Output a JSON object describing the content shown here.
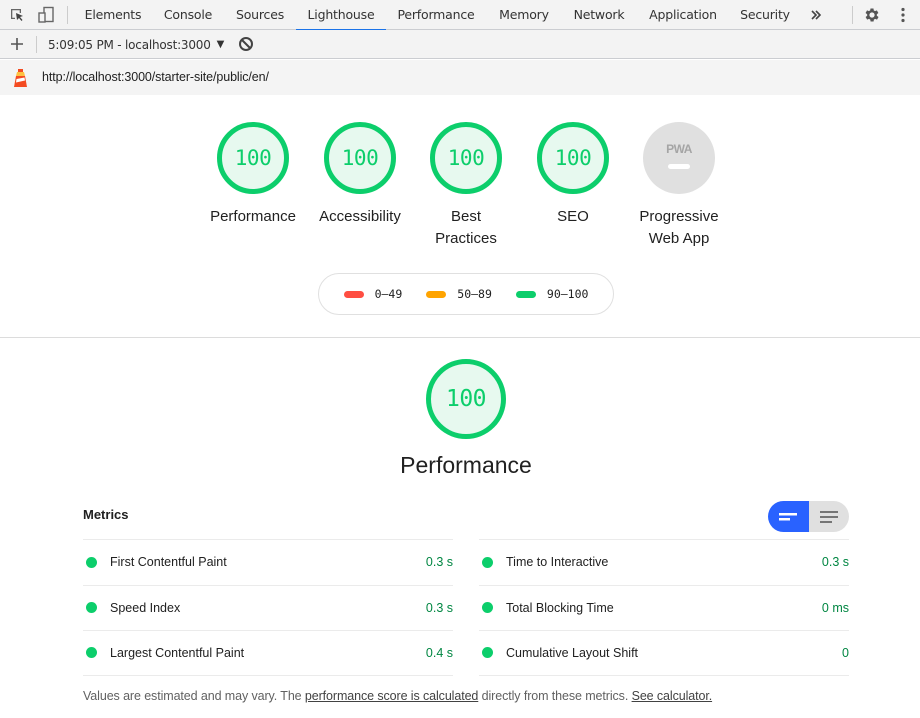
{
  "devtools": {
    "tabs": [
      {
        "label": "Elements",
        "active": false
      },
      {
        "label": "Console",
        "active": false
      },
      {
        "label": "Sources",
        "active": false
      },
      {
        "label": "Lighthouse",
        "active": true
      },
      {
        "label": "Performance",
        "active": false
      },
      {
        "label": "Memory",
        "active": false
      },
      {
        "label": "Network",
        "active": false
      },
      {
        "label": "Application",
        "active": false
      },
      {
        "label": "Security",
        "active": false
      }
    ],
    "more_tabs_icon": "chevron-double-right-icon",
    "accent_color": "#1a73e8"
  },
  "toolbar": {
    "report_selector": "5:09:05 PM - localhost:3000",
    "new_report_icon": "plus-icon",
    "clear_icon": "block-icon"
  },
  "report": {
    "url": "http://localhost:3000/starter-site/public/en/",
    "gauges": [
      {
        "label": "Performance",
        "score": "100"
      },
      {
        "label": "Accessibility",
        "score": "100"
      },
      {
        "label": "Best Practices",
        "score": "100"
      },
      {
        "label": "SEO",
        "score": "100"
      },
      {
        "label": "Progressive Web App",
        "score": null,
        "badge": "PWA"
      }
    ],
    "legend": [
      {
        "label": "0–49",
        "color": "#ff4e42"
      },
      {
        "label": "50–89",
        "color": "#ffa400"
      },
      {
        "label": "90–100",
        "color": "#0cce6b"
      }
    ],
    "performance": {
      "score": "100",
      "title": "Performance",
      "metrics_header": "Metrics",
      "metrics_left": [
        {
          "name": "First Contentful Paint",
          "value": "0.3 s"
        },
        {
          "name": "Speed Index",
          "value": "0.3 s"
        },
        {
          "name": "Largest Contentful Paint",
          "value": "0.4 s"
        }
      ],
      "metrics_right": [
        {
          "name": "Time to Interactive",
          "value": "0.3 s"
        },
        {
          "name": "Total Blocking Time",
          "value": "0 ms"
        },
        {
          "name": "Cumulative Layout Shift",
          "value": "0"
        }
      ],
      "footnote": {
        "prefix": "Values are estimated and may vary. The ",
        "link1": "performance score is calculated",
        "middle": " directly from these metrics. ",
        "link2": "See calculator."
      }
    },
    "colors": {
      "pass": "#0cce6b",
      "pass_bg": "#e7f9ef",
      "pass_text": "#018642",
      "toggle_active": "#2962ff"
    }
  }
}
